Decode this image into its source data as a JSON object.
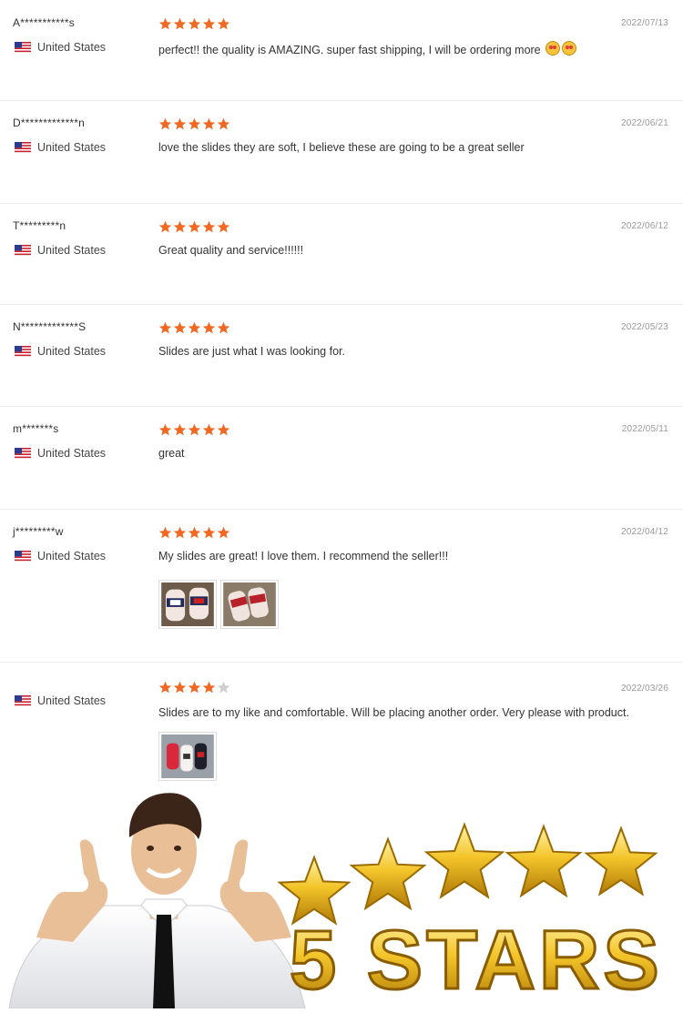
{
  "reviews": [
    {
      "reviewer": "A***********s",
      "country": "United States",
      "stars": 5,
      "date": "2022/07/13",
      "text": "perfect!! the quality is AMAZING. super fast shipping, I will be ordering more",
      "emoji_count": 2,
      "photos": 0
    },
    {
      "reviewer": "D*************n",
      "country": "United States",
      "stars": 5,
      "date": "2022/06/21",
      "text": "love the slides they are soft, I believe these are going to be a great seller",
      "emoji_count": 0,
      "photos": 0
    },
    {
      "reviewer": "T*********n",
      "country": "United States",
      "stars": 5,
      "date": "2022/06/12",
      "text": "Great quality and service!!!!!!",
      "emoji_count": 0,
      "photos": 0
    },
    {
      "reviewer": "N*************S",
      "country": "United States",
      "stars": 5,
      "date": "2022/05/23",
      "text": "Slides are just what I was looking for.",
      "emoji_count": 0,
      "photos": 0
    },
    {
      "reviewer": "m*******s",
      "country": "United States",
      "stars": 5,
      "date": "2022/05/11",
      "text": "great",
      "emoji_count": 0,
      "photos": 0
    },
    {
      "reviewer": "j*********w",
      "country": "United States",
      "stars": 5,
      "date": "2022/04/12",
      "text": "My slides are great! I love them. I recommend the seller!!!",
      "emoji_count": 0,
      "photos": 2
    },
    {
      "reviewer": "",
      "country": "United States",
      "stars": 4,
      "date": "2022/03/26",
      "text": "Slides are to my like and comfortable. Will be placing another order. Very please with product.",
      "emoji_count": 0,
      "photos": 1
    }
  ],
  "colors": {
    "star_filled": "#f26722",
    "star_empty": "#cfcfcf",
    "date": "#999999"
  },
  "banner": {
    "headline": "5 STARS",
    "star_count": 5
  }
}
